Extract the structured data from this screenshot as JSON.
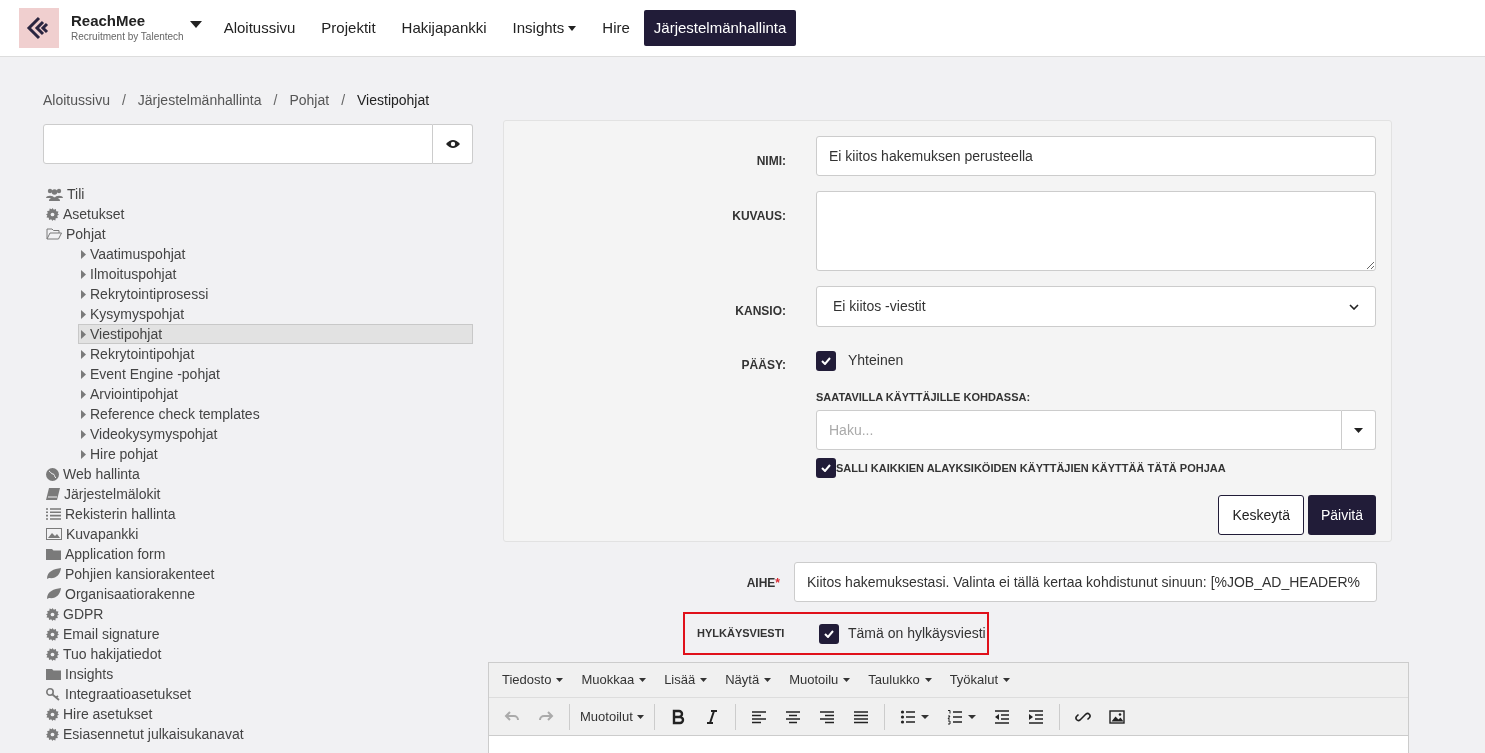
{
  "brand": {
    "name": "ReachMee",
    "tagline": "Recruitment by Talentech"
  },
  "nav": [
    {
      "label": "Aloitussivu",
      "dropdown": false,
      "selected": false
    },
    {
      "label": "Projektit",
      "dropdown": false,
      "selected": false
    },
    {
      "label": "Hakijapankki",
      "dropdown": false,
      "selected": false
    },
    {
      "label": "Insights",
      "dropdown": true,
      "selected": false
    },
    {
      "label": "Hire",
      "dropdown": false,
      "selected": false
    },
    {
      "label": "Järjestelmänhallinta",
      "dropdown": false,
      "selected": true
    }
  ],
  "breadcrumb": [
    {
      "label": "Aloitussivu",
      "separator": "/"
    },
    {
      "label": "Järjestelmänhallinta",
      "separator": "/"
    },
    {
      "label": "Pohjat",
      "separator": "/"
    },
    {
      "label": "Viestipohjat"
    }
  ],
  "sidebar": {
    "items": [
      {
        "label": "Tili",
        "kind": "users",
        "selected": false
      },
      {
        "label": "Asetukset",
        "kind": "gear",
        "selected": false
      },
      {
        "label": "Pohjat",
        "kind": "folderopen",
        "selected": false,
        "children": [
          {
            "label": "Vaatimuspohjat",
            "kind": "caret",
            "selected": false
          },
          {
            "label": "Ilmoituspohjat",
            "kind": "caret",
            "selected": false
          },
          {
            "label": "Rekrytointiprosessi",
            "kind": "caret",
            "selected": false
          },
          {
            "label": "Kysymyspohjat",
            "kind": "caret",
            "selected": false
          },
          {
            "label": "Viestipohjat",
            "kind": "caret",
            "selected": true
          },
          {
            "label": "Rekrytointipohjat",
            "kind": "caret",
            "selected": false
          },
          {
            "label": "Event Engine -pohjat",
            "kind": "caret",
            "selected": false
          },
          {
            "label": "Arviointipohjat",
            "kind": "caret",
            "selected": false
          },
          {
            "label": "Reference check templates",
            "kind": "caret",
            "selected": false
          },
          {
            "label": "Videokysymyspohjat",
            "kind": "caret",
            "selected": false
          },
          {
            "label": "Hire pohjat",
            "kind": "caret",
            "selected": false
          }
        ]
      },
      {
        "label": "Web hallinta",
        "kind": "globe",
        "selected": false
      },
      {
        "label": "Järjestelmälokit",
        "kind": "book",
        "selected": false
      },
      {
        "label": "Rekisterin hallinta",
        "kind": "list",
        "selected": false
      },
      {
        "label": "Kuvapankki",
        "kind": "image",
        "selected": false
      },
      {
        "label": "Application form",
        "kind": "folder",
        "selected": false
      },
      {
        "label": "Pohjien kansiorakenteet",
        "kind": "leaf",
        "selected": false
      },
      {
        "label": "Organisaatiorakenne",
        "kind": "leaf",
        "selected": false
      },
      {
        "label": "GDPR",
        "kind": "gear",
        "selected": false
      },
      {
        "label": "Email signature",
        "kind": "gear",
        "selected": false
      },
      {
        "label": "Tuo hakijatiedot",
        "kind": "gear",
        "selected": false
      },
      {
        "label": "Insights",
        "kind": "folder",
        "selected": false
      },
      {
        "label": "Integraatioasetukset",
        "kind": "key",
        "selected": false
      },
      {
        "label": "Hire asetukset",
        "kind": "gear",
        "selected": false
      },
      {
        "label": "Esiasennetut julkaisukanavat",
        "kind": "gear",
        "selected": false
      }
    ]
  },
  "form": {
    "name_label": "NIMI:",
    "name_value": "Ei kiitos hakemuksen perusteella",
    "description_label": "KUVAUS:",
    "folder_label": "KANSIO:",
    "folder_value": "Ei kiitos -viestit",
    "access_label": "PÄÄSY:",
    "shared": {
      "label": "Yhteinen",
      "checked": true
    },
    "available_label": "SAATAVILLA KÄYTTÄJILLE KOHDASSA:",
    "available_placeholder": "Haku...",
    "allow_sub": {
      "label": "SALLI KAIKKIEN ALAYKSIKÖIDEN KÄYTTÄJIEN KÄYTTÄÄ TÄTÄ POHJAA",
      "checked": true
    },
    "buttons": [
      "Keskeytä",
      "Päivitä"
    ]
  },
  "subject": {
    "label": "AIHE",
    "required_mark": "*",
    "value": "Kiitos hakemuksestasi. Valinta ei tällä kertaa kohdistunut sinuun: [%JOB_AD_HEADER%"
  },
  "rejection": {
    "label": "HYLKÄYSVIESTI",
    "checkbox_label": "Tämä on hylkäysviesti",
    "checked": true
  },
  "editor": {
    "menus": [
      "Tiedosto",
      "Muokkaa",
      "Lisää",
      "Näytä",
      "Muotoilu",
      "Taulukko",
      "Työkalut"
    ],
    "toolbar": [
      {
        "kind": "undo",
        "disabled": true
      },
      {
        "kind": "redo",
        "disabled": true
      },
      {
        "kind": "sep"
      },
      {
        "kind": "formats",
        "label": "Muotoilut"
      },
      {
        "kind": "sep"
      },
      {
        "kind": "bold"
      },
      {
        "kind": "italic"
      },
      {
        "kind": "sep"
      },
      {
        "kind": "alignleft"
      },
      {
        "kind": "aligncenter"
      },
      {
        "kind": "alignright"
      },
      {
        "kind": "justify"
      },
      {
        "kind": "sep"
      },
      {
        "kind": "bullets"
      },
      {
        "kind": "numbers"
      },
      {
        "kind": "outdent"
      },
      {
        "kind": "indent"
      },
      {
        "kind": "sep"
      },
      {
        "kind": "link"
      },
      {
        "kind": "image"
      }
    ]
  }
}
